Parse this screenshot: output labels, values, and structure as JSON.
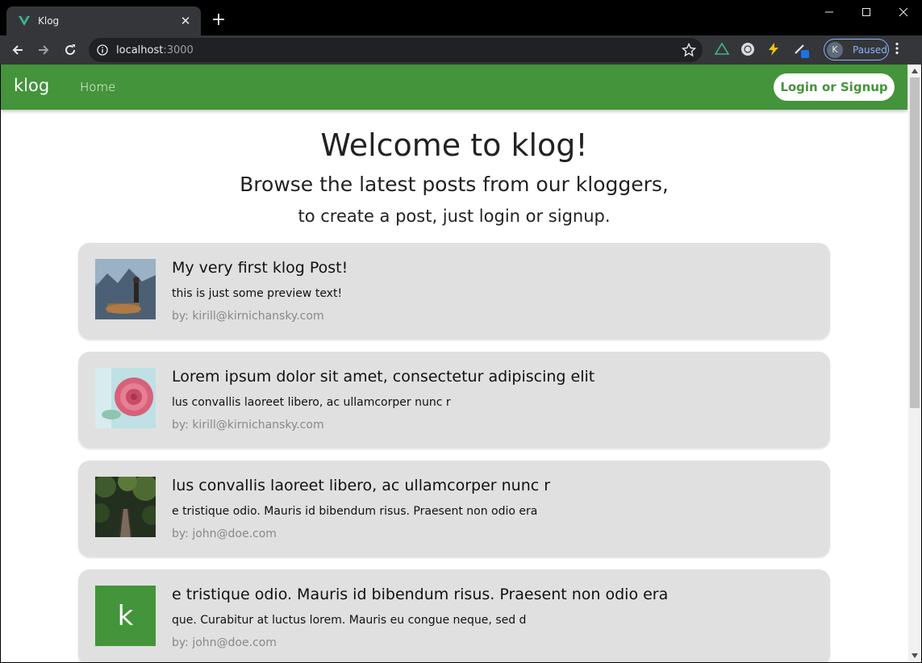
{
  "browser": {
    "tab_title": "Klog",
    "url_host": "localhost",
    "url_port": ":3000",
    "profile_initial": "K",
    "profile_status": "Paused"
  },
  "colors": {
    "brand_green": "#43943a",
    "card_bg": "#e0e0e0",
    "chrome_dark": "#35363a"
  },
  "appbar": {
    "brand": "klog",
    "nav_home": "Home",
    "login_label": "Login or Signup"
  },
  "hero": {
    "title": "Welcome to klog!",
    "subtitle_1": "Browse the latest posts from our kloggers,",
    "subtitle_2": "to create a post, just login or signup."
  },
  "posts": [
    {
      "title": "My very first klog Post!",
      "preview": "this is just some preview text!",
      "author": "by: kirill@kirnichansky.com",
      "thumb": "landscape-photo"
    },
    {
      "title": "Lorem ipsum dolor sit amet, consectetur adipiscing elit",
      "preview": "lus convallis laoreet libero, ac ullamcorper nunc r",
      "author": "by: kirill@kirnichansky.com",
      "thumb": "rose-photo"
    },
    {
      "title": "lus convallis laoreet libero, ac ullamcorper nunc r",
      "preview": "e tristique odio. Mauris id bibendum risus. Praesent non odio era",
      "author": "by: john@doe.com",
      "thumb": "forest-bridge-photo"
    },
    {
      "title": "e tristique odio. Mauris id bibendum risus. Praesent non odio era",
      "preview": "que. Curabitur at luctus lorem. Mauris eu congue neque, sed d",
      "author": "by: john@doe.com",
      "thumb_letter": "k"
    }
  ]
}
